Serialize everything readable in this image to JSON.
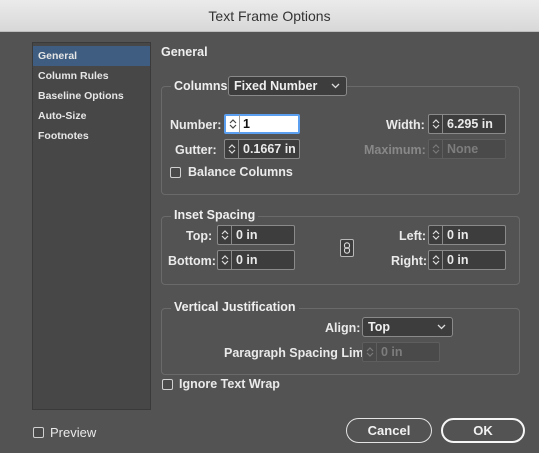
{
  "window": {
    "title": "Text Frame Options"
  },
  "sidebar": {
    "items": [
      {
        "label": "General",
        "active": true
      },
      {
        "label": "Column Rules"
      },
      {
        "label": "Baseline Options"
      },
      {
        "label": "Auto-Size"
      },
      {
        "label": "Footnotes"
      }
    ]
  },
  "general": {
    "title": "General",
    "columns": {
      "label": "Columns:",
      "type_value": "Fixed Number",
      "number_label": "Number:",
      "number_value": "1",
      "gutter_label": "Gutter:",
      "gutter_value": "0.1667 in",
      "width_label": "Width:",
      "width_value": "6.295 in",
      "maximum_label": "Maximum:",
      "maximum_value": "None",
      "balance_label": "Balance Columns"
    },
    "inset": {
      "title": "Inset Spacing",
      "top_label": "Top:",
      "top_value": "0 in",
      "bottom_label": "Bottom:",
      "bottom_value": "0 in",
      "left_label": "Left:",
      "left_value": "0 in",
      "right_label": "Right:",
      "right_value": "0 in"
    },
    "vertical": {
      "title": "Vertical Justification",
      "align_label": "Align:",
      "align_value": "Top",
      "para_label": "Paragraph Spacing Limit:",
      "para_value": "0 in"
    },
    "ignore_wrap_label": "Ignore Text Wrap"
  },
  "footer": {
    "preview_label": "Preview",
    "cancel_label": "Cancel",
    "ok_label": "OK"
  },
  "colors": {
    "dialog_bg": "#535353",
    "sidebar_bg": "#474747",
    "selection": "#3e5d80",
    "focus_ring": "#5b9ff0"
  }
}
